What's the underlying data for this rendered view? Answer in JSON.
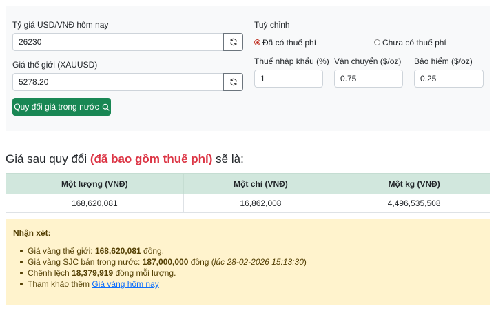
{
  "form": {
    "usd_vnd_label": "Tỷ giá USD/VNĐ hôm nay",
    "usd_vnd_value": "26230",
    "world_price_label": "Giá thế giới (XAUUSD)",
    "world_price_value": "5278.20",
    "convert_button": "Quy đổi giá trong nước",
    "customize_label": "Tuỳ chỉnh",
    "radio_with_fee": "Đã có thuế phí",
    "radio_without_fee": "Chưa có thuế phí",
    "radio_selected": "with_fee",
    "import_tax_label": "Thuế nhập khẩu (%)",
    "import_tax_value": "1",
    "shipping_label": "Vận chuyển ($/oz)",
    "shipping_value": "0.75",
    "insurance_label": "Bảo hiểm ($/oz)",
    "insurance_value": "0.25"
  },
  "result": {
    "heading_prefix": "Giá sau quy đổi",
    "heading_highlight": "(đã bao gồm thuế phí)",
    "heading_suffix": "sẽ là:",
    "columns": [
      "Một lượng (VNĐ)",
      "Một chỉ (VNĐ)",
      "Một kg (VNĐ)"
    ],
    "values": [
      "168,620,081",
      "16,862,008",
      "4,496,535,508"
    ]
  },
  "notes": {
    "title": "Nhận xét:",
    "world_prefix": "Giá vàng thế giới:",
    "world_value": "168,620,081",
    "world_suffix": "đồng.",
    "sjc_prefix": "Giá vàng SJC bán trong nước:",
    "sjc_value": "187,000,000",
    "sjc_unit": "đồng",
    "sjc_time": "lúc 28-02-2026 15:13:30",
    "diff_prefix": "Chênh lệch",
    "diff_value": "18,379,919",
    "diff_suffix": "đồng mỗi lượng.",
    "ref_prefix": "Tham khảo thêm",
    "ref_link": "Giá vàng hôm nay"
  },
  "colors": {
    "primary_button": "#198754",
    "highlight": "#dc3545",
    "table_header": "#d1e7dd",
    "note_bg": "#fff3cd",
    "link": "#0d6efd"
  }
}
